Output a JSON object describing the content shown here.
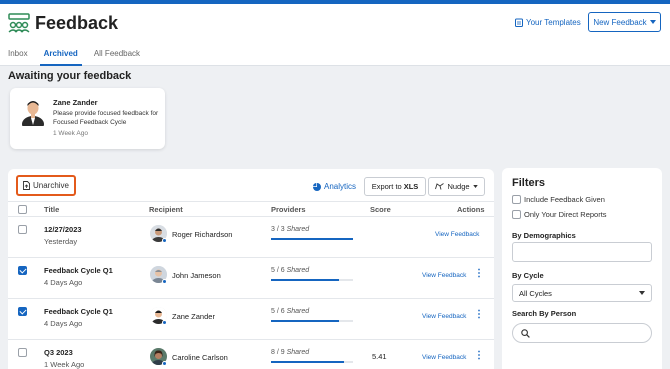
{
  "app": {
    "title": "Feedback",
    "your_templates_label": "Your Templates",
    "new_feedback_label": "New Feedback"
  },
  "tabs": [
    {
      "label": "Inbox",
      "active": false
    },
    {
      "label": "Archived",
      "active": true
    },
    {
      "label": "All Feedback",
      "active": false
    }
  ],
  "awaiting": {
    "heading": "Awaiting your feedback",
    "card": {
      "name": "Zane Zander",
      "message": "Please provide focused feedback for Focused Feedback Cycle",
      "time": "1 Week Ago"
    }
  },
  "toolbar": {
    "unarchive_label": "Unarchive",
    "analytics_label": "Analytics",
    "export_label": "Export to",
    "export_format": "XLS",
    "nudge_label": "Nudge"
  },
  "table": {
    "headers": {
      "title": "Title",
      "recipient": "Recipient",
      "providers": "Providers",
      "score": "Score",
      "actions": "Actions"
    },
    "rows": [
      {
        "checked": false,
        "title": "12/27/2023",
        "subtitle": "Yesterday",
        "recipient": "Roger Richardson",
        "providers_count": "3 / 3",
        "providers_status": "Shared",
        "progress": 1.0,
        "score": "",
        "action": "View Feedback",
        "has_menu": false
      },
      {
        "checked": true,
        "title": "Feedback Cycle Q1",
        "subtitle": "4 Days Ago",
        "recipient": "John Jameson",
        "providers_count": "5 / 6",
        "providers_status": "Shared",
        "progress": 0.83,
        "score": "",
        "action": "View Feedback",
        "has_menu": true
      },
      {
        "checked": true,
        "title": "Feedback Cycle Q1",
        "subtitle": "4 Days Ago",
        "recipient": "Zane Zander",
        "providers_count": "5 / 6",
        "providers_status": "Shared",
        "progress": 0.83,
        "score": "",
        "action": "View Feedback",
        "has_menu": true
      },
      {
        "checked": false,
        "title": "Q3 2023",
        "subtitle": "1 Week Ago",
        "recipient": "Caroline Carlson",
        "providers_count": "8 / 9",
        "providers_status": "Shared",
        "progress": 0.89,
        "score": "5.41",
        "action": "View Feedback",
        "has_menu": true
      }
    ]
  },
  "filters": {
    "title": "Filters",
    "include_given_label": "Include Feedback Given",
    "direct_reports_label": "Only Your Direct Reports",
    "demographics_label": "By Demographics",
    "cycle_label": "By Cycle",
    "cycle_value": "All Cycles",
    "person_label": "Search By Person"
  },
  "colors": {
    "accent": "#1565c0",
    "highlight": "#e35a1b"
  }
}
